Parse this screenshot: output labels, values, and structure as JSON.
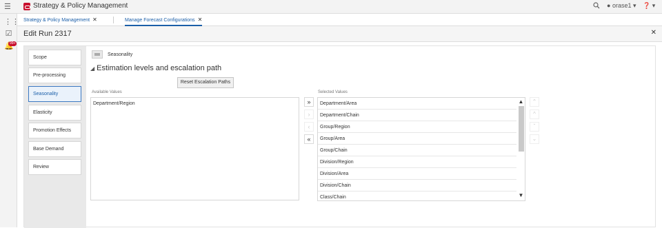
{
  "topbar": {
    "app_title": "Strategy & Policy Management",
    "user": "orase1",
    "user_caret": "▾",
    "help_caret": "▾"
  },
  "left_rail": {
    "notification_badge": "99+"
  },
  "tabs": [
    {
      "label": "Strategy & Policy Management",
      "close": "✕"
    },
    {
      "label": "Manage Forecast Configurations",
      "close": "✕"
    }
  ],
  "edit": {
    "title": "Edit Run 2317",
    "close": "✕"
  },
  "steps": [
    {
      "label": "Scope"
    },
    {
      "label": "Pre-processing"
    },
    {
      "label": "Seasonality"
    },
    {
      "label": "Elasticity"
    },
    {
      "label": "Promotion Effects"
    },
    {
      "label": "Base Demand"
    },
    {
      "label": "Review"
    }
  ],
  "section": {
    "label": "Seasonality",
    "subheading": "Estimation levels and escalation path",
    "reset_button": "Reset Escalation Paths"
  },
  "shuttle": {
    "available_label": "Available Values",
    "selected_label": "Selected Values",
    "available_items": [
      "Department/Region"
    ],
    "selected_items": [
      "Department/Area",
      "Department/Chain",
      "Group/Region",
      "Group/Area",
      "Group/Chain",
      "Division/Region",
      "Division/Area",
      "Division/Chain",
      "Class/Chain"
    ],
    "move_buttons": [
      "»",
      "›",
      "‹",
      "«"
    ],
    "order_buttons": [
      "⌃",
      "^",
      "ˇ",
      "⌄"
    ]
  },
  "colors": {
    "accent": "#1a5ea8",
    "oracle_red": "#c8102e"
  }
}
